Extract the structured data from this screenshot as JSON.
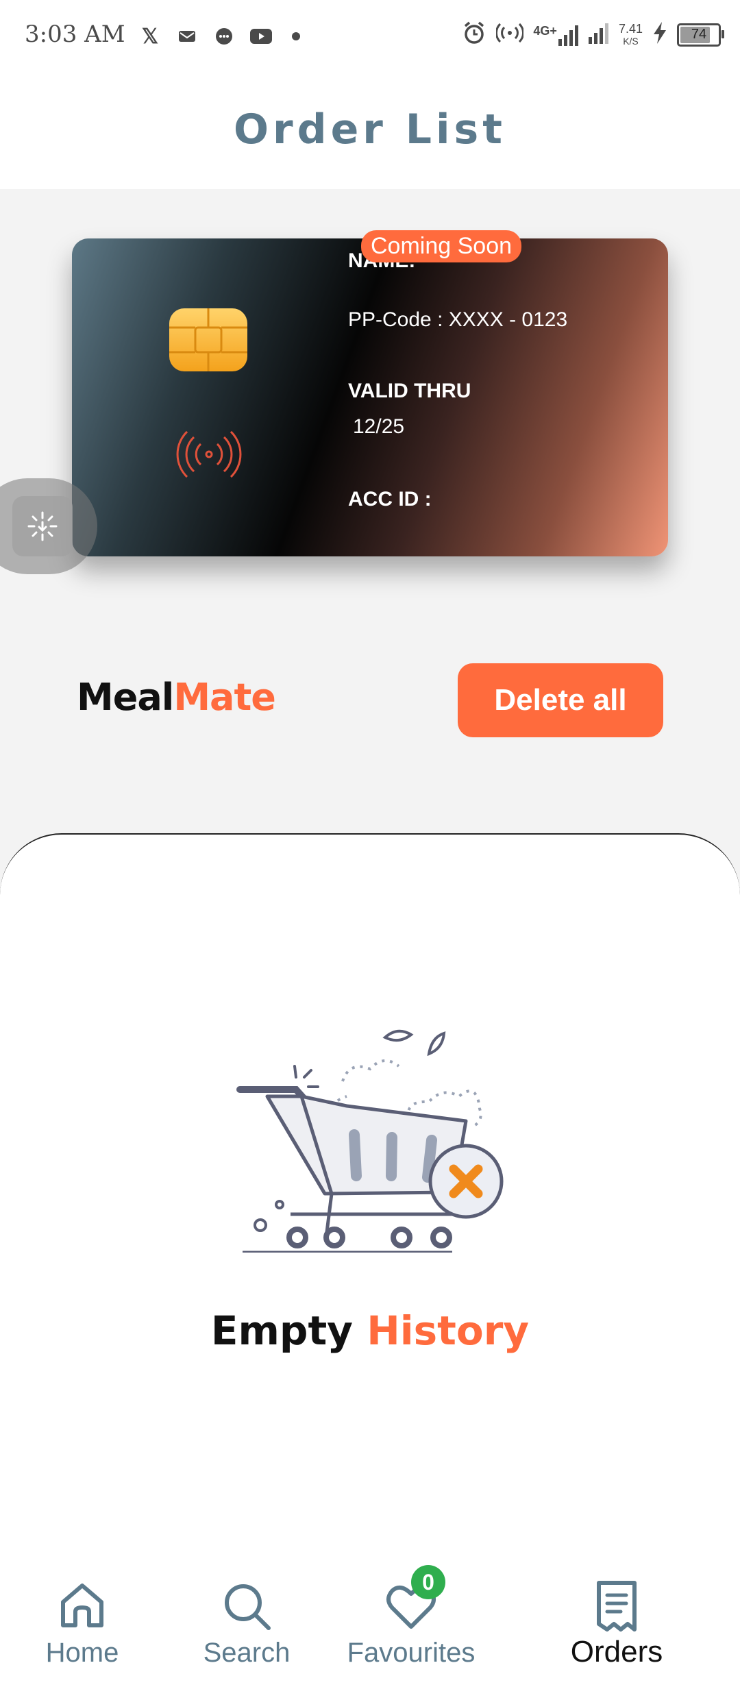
{
  "status_bar": {
    "time": "3:03 AM",
    "network_type": "4G+",
    "net_speed_value": "7.41",
    "net_speed_unit": "K/S",
    "battery": "74"
  },
  "header": {
    "title": "Order List"
  },
  "card": {
    "badge": "Coming Soon",
    "name_label": "NAME:",
    "pp_code": "PP-Code : XXXX - 0123",
    "valid_label": "VALID THRU",
    "valid_value": "12/25",
    "acc_label": "ACC ID :"
  },
  "brand": {
    "part1": "Meal",
    "part2": "Mate"
  },
  "actions": {
    "delete_all": "Delete all"
  },
  "empty_state": {
    "part1": "Empty",
    "part2": "History"
  },
  "nav": {
    "items": [
      {
        "label": "Home",
        "icon": "home-icon",
        "active": false
      },
      {
        "label": "Search",
        "icon": "search-icon",
        "active": false
      },
      {
        "label": "Favourites",
        "icon": "heart-icon",
        "active": false,
        "badge": "0"
      },
      {
        "label": "Orders",
        "icon": "receipt-icon",
        "active": true
      }
    ]
  },
  "colors": {
    "accent": "#ff6b3d",
    "title": "#5c7a8c",
    "badge_green": "#2fae4e"
  }
}
